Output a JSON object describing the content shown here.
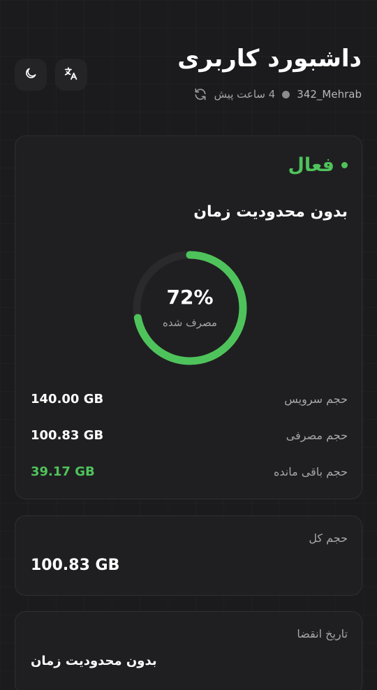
{
  "header": {
    "title": "داشبورد کاربری",
    "username": "342_Mehrab",
    "last_update": "4 ساعت پیش"
  },
  "icons": {
    "theme": "moon-icon",
    "language": "translate-icon",
    "refresh": "refresh-icon"
  },
  "status": {
    "label": "فعال",
    "color": "#4fc35b"
  },
  "plan": {
    "duration": "بدون محدودیت زمان"
  },
  "usage": {
    "percent": 72,
    "percent_label": "72%",
    "caption": "مصرف شده"
  },
  "stats": [
    {
      "label": "حجم سرویس",
      "value": "140.00 GB"
    },
    {
      "label": "حجم مصرفی",
      "value": "100.83 GB"
    },
    {
      "label": "حجم باقی مانده",
      "value": "39.17 GB"
    }
  ],
  "total": {
    "label": "حجم کل",
    "value": "100.83 GB"
  },
  "expiry": {
    "label": "تاریخ انقضا",
    "value": "بدون محدودیت زمان"
  },
  "colors": {
    "accent": "#4fc35b",
    "background": "#1b1b1d",
    "card": "#1f1f21",
    "muted_text": "#a6a6ab"
  }
}
